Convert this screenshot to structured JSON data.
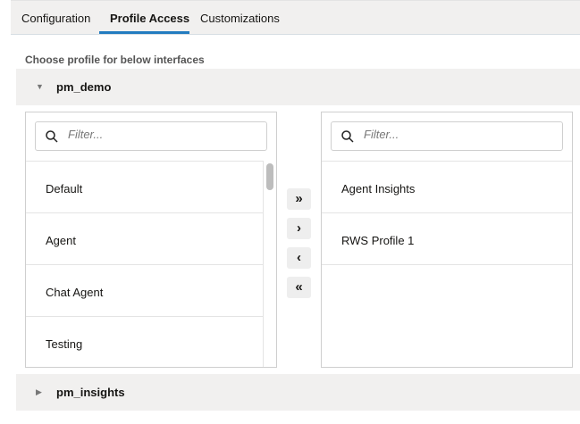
{
  "tabs": [
    {
      "label": "Configuration"
    },
    {
      "label": "Profile Access"
    },
    {
      "label": "Customizations"
    }
  ],
  "section_label": "Choose profile for below interfaces",
  "groups": [
    {
      "title": "pm_demo",
      "expanded": true
    },
    {
      "title": "pm_insights",
      "expanded": false
    }
  ],
  "available": {
    "filter_placeholder": "Filter...",
    "items": [
      "Default",
      "Agent",
      "Chat Agent",
      "Testing"
    ]
  },
  "selected": {
    "filter_placeholder": "Filter...",
    "items": [
      "Agent Insights",
      "RWS Profile 1"
    ]
  },
  "buttons": {
    "move_all_right": "»",
    "move_right": "›",
    "move_left": "‹",
    "move_all_left": "«"
  },
  "colors": {
    "accent": "#227bbf"
  }
}
